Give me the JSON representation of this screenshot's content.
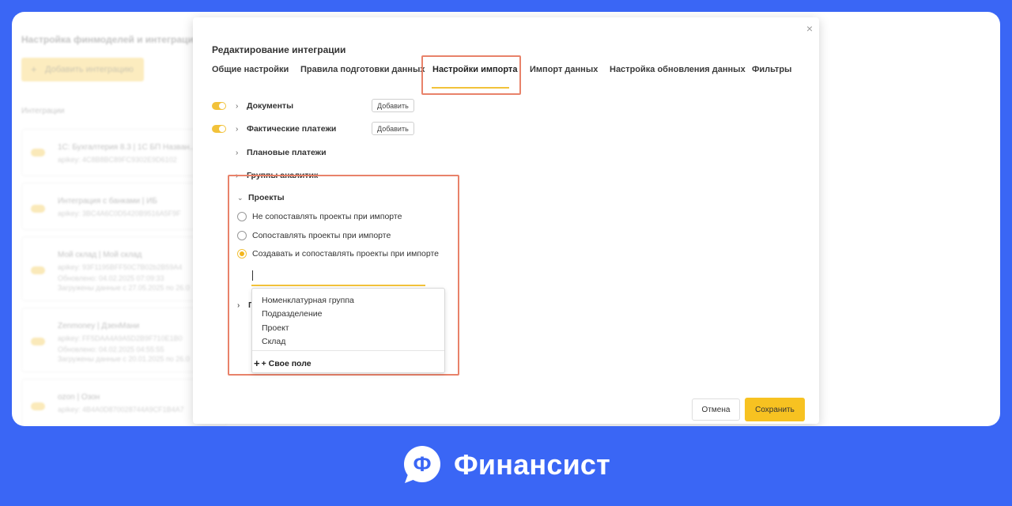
{
  "background_app": {
    "title": "Настройка финмоделей и интеграций",
    "add_button": "Добавить интеграцию",
    "section_label": "Интеграции",
    "items": [
      {
        "name": "1С: Бухгалтерия 8.3 | 1С БП Назван...",
        "apikey": "apikey: 4C8B8BC89FC9302E9D6102",
        "extra": []
      },
      {
        "name": "Интеграция с банками | ИБ",
        "apikey": "apikey: 3BC4A6C0D5420B9516A5F9F",
        "extra": []
      },
      {
        "name": "Мой склад | Мой склад",
        "apikey": "apikey: 93F1195BFF50C7B02b2B59A4",
        "extra": [
          "Обновлено: 04.02.2025 07:09:33",
          "Загружены данные с 27.05.2025 по 26.0"
        ]
      },
      {
        "name": "Zenmoney | ДзенМани",
        "apikey": "apikey: FF5DAA4A9A5D2B9F710E1B0",
        "extra": [
          "Обновлено: 04.02.2025 04:55:55",
          "Загружены данные с 20.01.2025 по 26.0"
        ]
      },
      {
        "name": "ozon | Озон",
        "apikey": "apikey: 4B4A0D870028744A9CF1B4A7",
        "extra": []
      }
    ]
  },
  "modal": {
    "title": "Редактирование интеграции",
    "close_icon": "×",
    "tabs": [
      {
        "label": "Общие настройки",
        "active": false
      },
      {
        "label": "Правила подготовки данных",
        "active": false
      },
      {
        "label": "Настройки импорта",
        "active": true
      },
      {
        "label": "Импорт данных",
        "active": false
      },
      {
        "label": "Настройка обновления данных",
        "active": false
      },
      {
        "label": "Фильтры",
        "active": false
      }
    ],
    "sections": [
      {
        "label": "Документы",
        "toggle": true,
        "add_label": "Добавить"
      },
      {
        "label": "Фактические платежи",
        "toggle": true,
        "add_label": "Добавить"
      },
      {
        "label": "Плановые платежи",
        "toggle": false
      },
      {
        "label": "Группы аналитик",
        "toggle": false
      }
    ],
    "projects": {
      "label": "Проекты",
      "options": [
        {
          "label": "Не сопоставлять проекты при импорте",
          "checked": false
        },
        {
          "label": "Сопоставлять проекты при импорте",
          "checked": false
        },
        {
          "label": "Создавать и сопоставлять проекты при импорте",
          "checked": true
        }
      ],
      "input_value": "",
      "hidden_row_initial": "П",
      "dropdown": {
        "items": [
          "Номенклатурная группа",
          "Подразделение",
          "Проект",
          "Склад"
        ],
        "custom_field": "+ Свое поле"
      }
    },
    "cancel_label": "Отмена",
    "save_label": "Сохранить"
  },
  "brand": {
    "name": "Финансист",
    "logo_letter": "Ф"
  },
  "colors": {
    "background": "#3a66f5",
    "accent": "#f2c23a",
    "highlight": "#e8826a"
  }
}
